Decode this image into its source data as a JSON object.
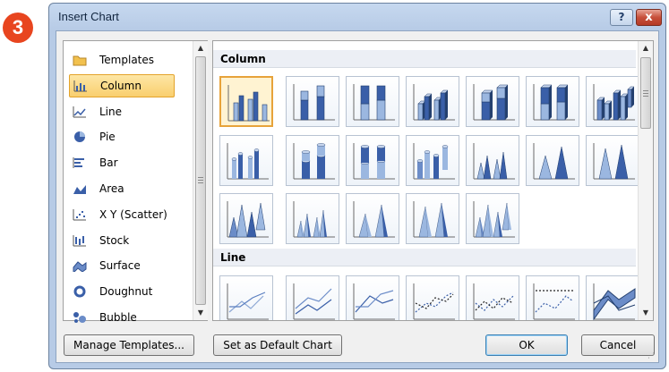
{
  "step_badge": "3",
  "dialog": {
    "title": "Insert Chart",
    "help_label": "?",
    "close_label": "x"
  },
  "categories": [
    {
      "label": "Templates",
      "icon": "folder-icon",
      "selected": false
    },
    {
      "label": "Column",
      "icon": "column-chart-icon",
      "selected": true
    },
    {
      "label": "Line",
      "icon": "line-chart-icon",
      "selected": false
    },
    {
      "label": "Pie",
      "icon": "pie-chart-icon",
      "selected": false
    },
    {
      "label": "Bar",
      "icon": "bar-chart-icon",
      "selected": false
    },
    {
      "label": "Area",
      "icon": "area-chart-icon",
      "selected": false
    },
    {
      "label": "X Y (Scatter)",
      "icon": "scatter-chart-icon",
      "selected": false
    },
    {
      "label": "Stock",
      "icon": "stock-chart-icon",
      "selected": false
    },
    {
      "label": "Surface",
      "icon": "surface-chart-icon",
      "selected": false
    },
    {
      "label": "Doughnut",
      "icon": "doughnut-chart-icon",
      "selected": false
    },
    {
      "label": "Bubble",
      "icon": "bubble-chart-icon",
      "selected": false
    }
  ],
  "gallery": {
    "sections": [
      {
        "label": "Column",
        "count": 19,
        "selected_index": 0
      },
      {
        "label": "Line",
        "count": 7
      }
    ]
  },
  "buttons": {
    "manage_templates": "Manage Templates...",
    "set_default": "Set as Default Chart",
    "ok": "OK",
    "cancel": "Cancel"
  },
  "colors": {
    "accent_badge": "#e8451f",
    "selection": "#f9cf6e",
    "chart_blue": "#3a5fa8"
  }
}
